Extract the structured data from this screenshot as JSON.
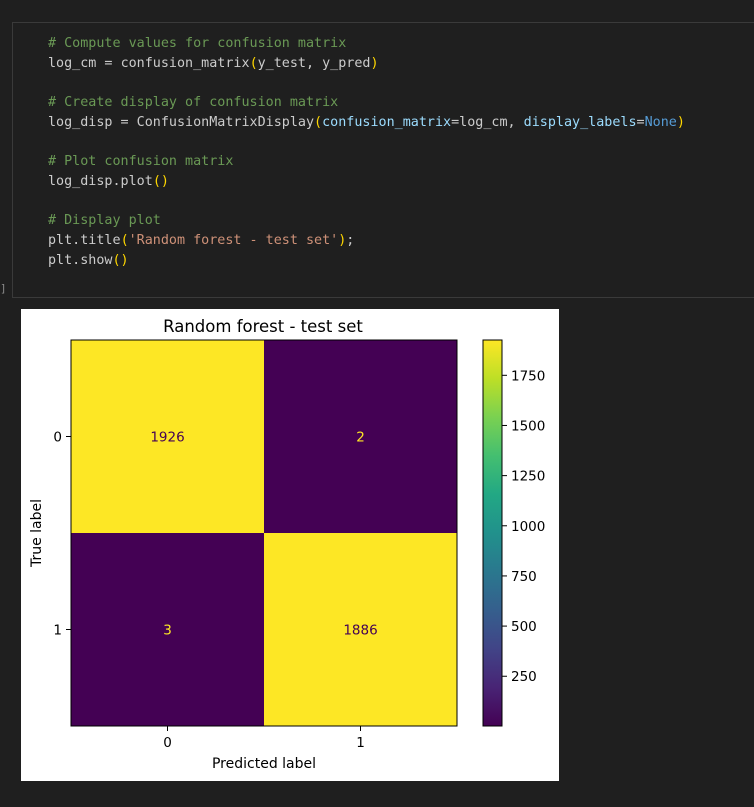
{
  "cell": {
    "execution_marker": "]",
    "code_lines": [
      [
        {
          "t": "# Compute values for confusion matrix",
          "c": "cm"
        }
      ],
      [
        {
          "t": "log_cm",
          "c": "pl"
        },
        {
          "t": " = ",
          "c": "pl"
        },
        {
          "t": "confusion_matrix",
          "c": "pl"
        },
        {
          "t": "(",
          "c": "br"
        },
        {
          "t": "y_test, y_pred",
          "c": "pl"
        },
        {
          "t": ")",
          "c": "br"
        }
      ],
      [],
      [
        {
          "t": "# Create display of confusion matrix",
          "c": "cm"
        }
      ],
      [
        {
          "t": "log_disp = ConfusionMatrixDisplay",
          "c": "pl"
        },
        {
          "t": "(",
          "c": "br"
        },
        {
          "t": "confusion_matrix",
          "c": "var"
        },
        {
          "t": "=",
          "c": "pl"
        },
        {
          "t": "log_cm, ",
          "c": "pl"
        },
        {
          "t": "display_labels",
          "c": "var"
        },
        {
          "t": "=",
          "c": "pl"
        },
        {
          "t": "None",
          "c": "kw"
        },
        {
          "t": ")",
          "c": "br"
        }
      ],
      [],
      [
        {
          "t": "# Plot confusion matrix",
          "c": "cm"
        }
      ],
      [
        {
          "t": "log_disp.plot",
          "c": "pl"
        },
        {
          "t": "()",
          "c": "br"
        }
      ],
      [],
      [
        {
          "t": "# Display plot",
          "c": "cm"
        }
      ],
      [
        {
          "t": "plt.title",
          "c": "pl"
        },
        {
          "t": "(",
          "c": "br"
        },
        {
          "t": "'Random forest - test set'",
          "c": "str"
        },
        {
          "t": ")",
          "c": "br"
        },
        {
          "t": ";",
          "c": "pl"
        }
      ],
      [
        {
          "t": "plt.show",
          "c": "pl"
        },
        {
          "t": "()",
          "c": "br"
        }
      ]
    ]
  },
  "chart_data": {
    "type": "heatmap",
    "title": "Random forest - test set",
    "xlabel": "Predicted label",
    "ylabel": "True label",
    "x_tick_labels": [
      "0",
      "1"
    ],
    "y_tick_labels": [
      "0",
      "1"
    ],
    "matrix": [
      [
        1926,
        2
      ],
      [
        3,
        1886
      ]
    ],
    "colormap": "viridis",
    "colorbar": {
      "ticks": [
        250,
        500,
        750,
        1000,
        1250,
        1500,
        1750
      ],
      "tick_labels": [
        "250",
        "500",
        "750",
        "1000",
        "1250",
        "1500",
        "1750"
      ],
      "min": 2,
      "max": 1926
    },
    "colors": {
      "low": "#440154",
      "high": "#fde725",
      "text_on_dark": "#fde725",
      "text_on_light": "#440154"
    }
  }
}
